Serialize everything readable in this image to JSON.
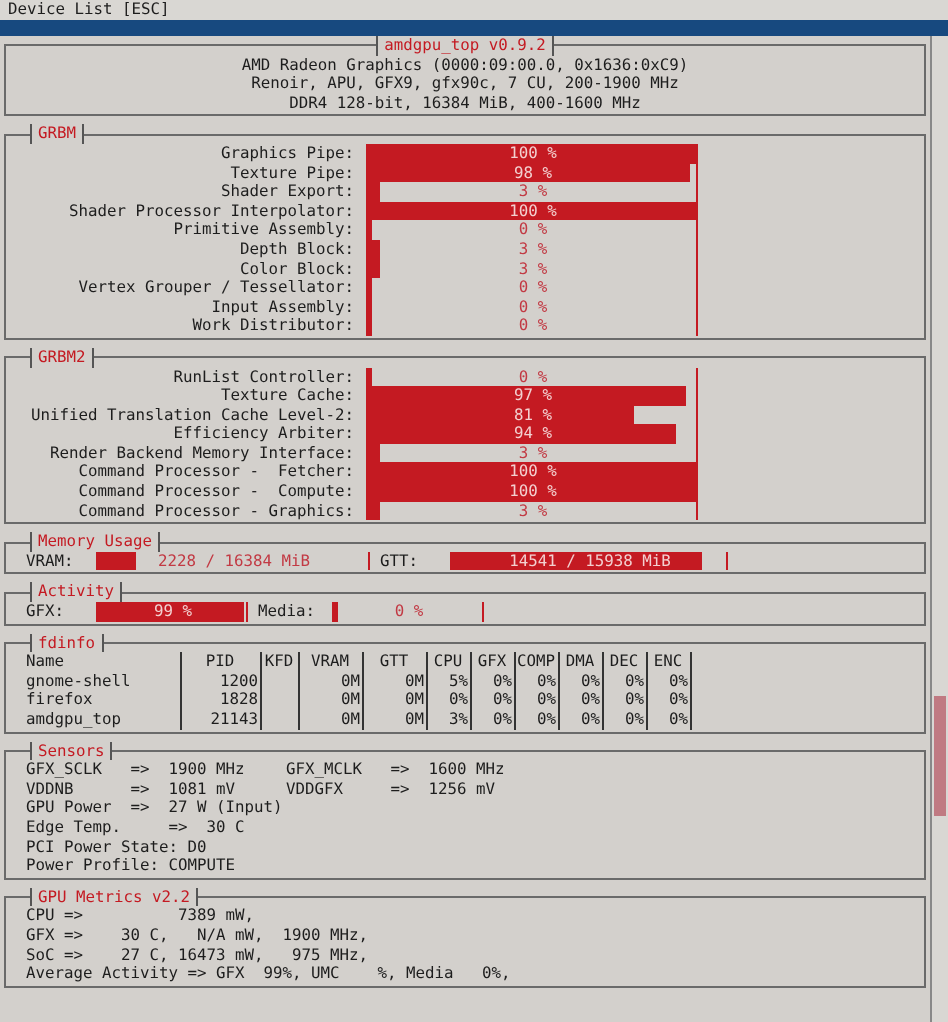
{
  "top_bar": {
    "text": "Device List [ESC]"
  },
  "header": {
    "title": "amdgpu_top v0.9.2",
    "lines": [
      "AMD Radeon Graphics (0000:09:00.0, 0x1636:0xC9)",
      "Renoir, APU, GFX9, gfx90c, 7 CU, 200-1900 MHz",
      "DDR4 128-bit, 16384 MiB, 400-1600 MHz"
    ]
  },
  "grbm": {
    "title": "GRBM",
    "rows": [
      {
        "label": "Graphics Pipe:",
        "reading": "100 %",
        "level": 1.0
      },
      {
        "label": "Texture Pipe:",
        "reading": "98 %",
        "level": 0.98
      },
      {
        "label": "Shader Export:",
        "reading": "3 %",
        "level": 0.03
      },
      {
        "label": "Shader Processor Interpolator:",
        "reading": "100 %",
        "level": 1.0
      },
      {
        "label": "Primitive Assembly:",
        "reading": "0 %",
        "level": 0
      },
      {
        "label": "Depth Block:",
        "reading": "3 %",
        "level": 0.03
      },
      {
        "label": "Color Block:",
        "reading": "3 %",
        "level": 0.03
      },
      {
        "label": "Vertex Grouper / Tessellator:",
        "reading": "0 %",
        "level": 0
      },
      {
        "label": "Input Assembly:",
        "reading": "0 %",
        "level": 0
      },
      {
        "label": "Work Distributor:",
        "reading": "0 %",
        "level": 0
      }
    ]
  },
  "grbm2": {
    "title": "GRBM2",
    "rows": [
      {
        "label": "RunList Controller:",
        "reading": "0 %",
        "level": 0
      },
      {
        "label": "Texture Cache:",
        "reading": "97 %",
        "level": 0.97
      },
      {
        "label": "Unified Translation Cache Level-2:",
        "reading": "81 %",
        "level": 0.81
      },
      {
        "label": "Efficiency Arbiter:",
        "reading": "94 %",
        "level": 0.94
      },
      {
        "label": "Render Backend Memory Interface:",
        "reading": "3 %",
        "level": 0.03
      },
      {
        "label": "Command Processor -  Fetcher:",
        "reading": "100 %",
        "level": 1.0
      },
      {
        "label": "Command Processor -  Compute:",
        "reading": "100 %",
        "level": 1.0
      },
      {
        "label": "Command Processor - Graphics:",
        "reading": "3 %",
        "level": 0.03
      }
    ]
  },
  "memory_usage": {
    "title": "Memory Usage",
    "meters": [
      {
        "label": "VRAM:",
        "reading": "2228 / 16384 MiB",
        "level": 0.136
      },
      {
        "label": "GTT:",
        "reading": "14541 / 15938 MiB",
        "level": 0.912
      }
    ]
  },
  "activity": {
    "title": "Activity",
    "meters": [
      {
        "label": "GFX:",
        "reading": "99 %",
        "level": 0.99
      },
      {
        "label": "Media:",
        "reading": "0 %",
        "level": 0
      }
    ]
  },
  "fdinfo": {
    "title": "fdinfo",
    "columns": [
      "Name",
      "PID",
      "KFD",
      "VRAM",
      "GTT",
      "CPU",
      "GFX",
      "COMP",
      "DMA",
      "DEC",
      "ENC"
    ],
    "rows": [
      [
        "gnome-shell",
        "1200",
        "",
        "0M",
        "0M",
        "5%",
        "0%",
        "0%",
        "0%",
        "0%",
        "0%"
      ],
      [
        "firefox",
        "1828",
        "",
        "0M",
        "0M",
        "0%",
        "0%",
        "0%",
        "0%",
        "0%",
        "0%"
      ],
      [
        "amdgpu_top",
        "21143",
        "",
        "0M",
        "0M",
        "3%",
        "0%",
        "0%",
        "0%",
        "0%",
        "0%"
      ]
    ]
  },
  "sensors": {
    "title": "Sensors",
    "rows": [
      [
        "GFX_SCLK   =>  1900 MHz",
        "GFX_MCLK   =>  1600 MHz"
      ],
      [
        "VDDNB      =>  1081 mV",
        "VDDGFX     =>  1256 mV"
      ],
      [
        "GPU Power  =>  27 W (Input)"
      ],
      [
        "Edge Temp.     =>  30 C"
      ],
      [
        "PCI Power State: D0"
      ],
      [
        "Power Profile: COMPUTE"
      ]
    ]
  },
  "gpu_metrics": {
    "title": "GPU Metrics v2.2",
    "lines": [
      "CPU =>          7389 mW,",
      "GFX =>    30 C,   N/A mW,  1900 MHz,",
      "SoC =>    27 C, 16473 mW,   975 MHz,",
      "Average Activity => GFX  99%, UMC    %, Media   0%,"
    ]
  }
}
